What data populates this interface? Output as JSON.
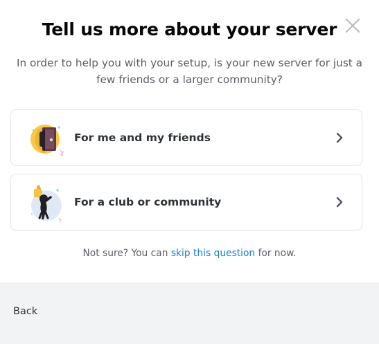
{
  "modal": {
    "title": "Tell us more about your server",
    "subtitle": "In order to help you with your setup, is your new server for just a few friends or a larger community?",
    "close_icon": "close-icon"
  },
  "options": [
    {
      "label": "For me and my friends",
      "icon": "friends-illustration",
      "chevron": "chevron-right-icon"
    },
    {
      "label": "For a club or community",
      "icon": "community-illustration",
      "chevron": "chevron-right-icon"
    }
  ],
  "footer_note": {
    "prefix": "Not sure? You can ",
    "link": "skip this question",
    "suffix": " for now."
  },
  "footer": {
    "back_label": "Back"
  },
  "colors": {
    "title": "#060607",
    "body_text": "#5c5e66",
    "link": "#1a7bd6",
    "card_border": "#e3e5e8",
    "footer_bg": "#f2f3f5"
  }
}
